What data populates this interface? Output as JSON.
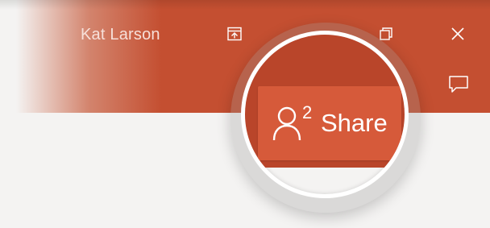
{
  "titlebar": {
    "user_name": "Kat Larson",
    "icons": {
      "ribbon_display": "ribbon-display-options-icon",
      "restore": "restore-window-icon",
      "close": "close-icon",
      "comments": "comments-icon"
    }
  },
  "share": {
    "label": "Share",
    "people_count": "2",
    "icon": "person-icon"
  },
  "colors": {
    "titlebar": "#c44f31",
    "share_button": "#d65a3a",
    "background": "#f4f3f2"
  }
}
